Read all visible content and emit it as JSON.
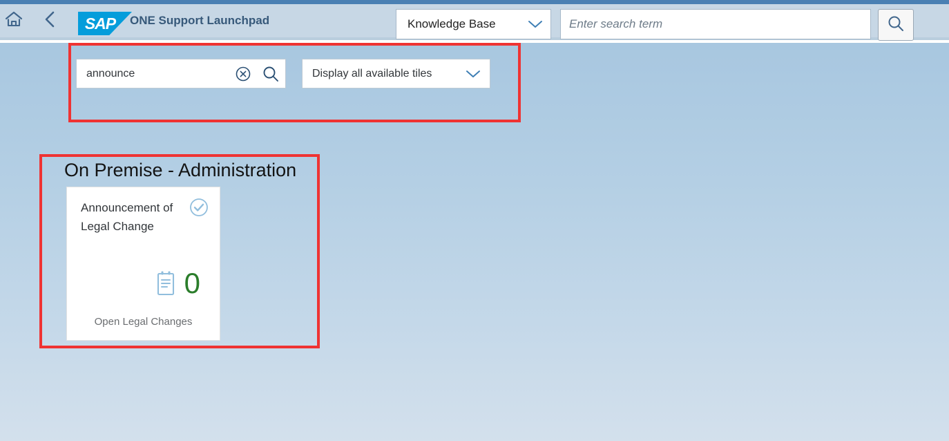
{
  "header": {
    "home_icon": "home-icon",
    "back_icon": "chevron-left-icon",
    "logo_text": "SAP",
    "app_title": "ONE Support Launchpad",
    "scope_selected": "Knowledge Base",
    "scope_arrow_icon": "chevron-down-icon",
    "search_placeholder": "Enter search term",
    "search_value": "",
    "search_button_icon": "search-icon"
  },
  "filter_bar": {
    "search_value": "announce",
    "search_placeholder": "Search",
    "clear_icon": "clear-circle-icon",
    "go_icon": "search-icon",
    "select_value": "Display all available tiles",
    "select_arrow_icon": "chevron-down-icon"
  },
  "group": {
    "title": "On Premise - Administration",
    "tiles": [
      {
        "title": "Announcement of Legal Change",
        "status_icon": "check-circle-icon",
        "kpi_icon": "clipboard-icon",
        "kpi_value": "0",
        "footer": "Open Legal Changes",
        "kpi_color": "#2b7d2b"
      }
    ]
  },
  "colors": {
    "highlight": "#ef3333",
    "brand_blue": "#049ddb",
    "header_bg": "#c7d7e5",
    "accent_strip": "#4a80b3",
    "icon_blue": "#41668c",
    "tile_icon_blue": "#91bedd"
  }
}
